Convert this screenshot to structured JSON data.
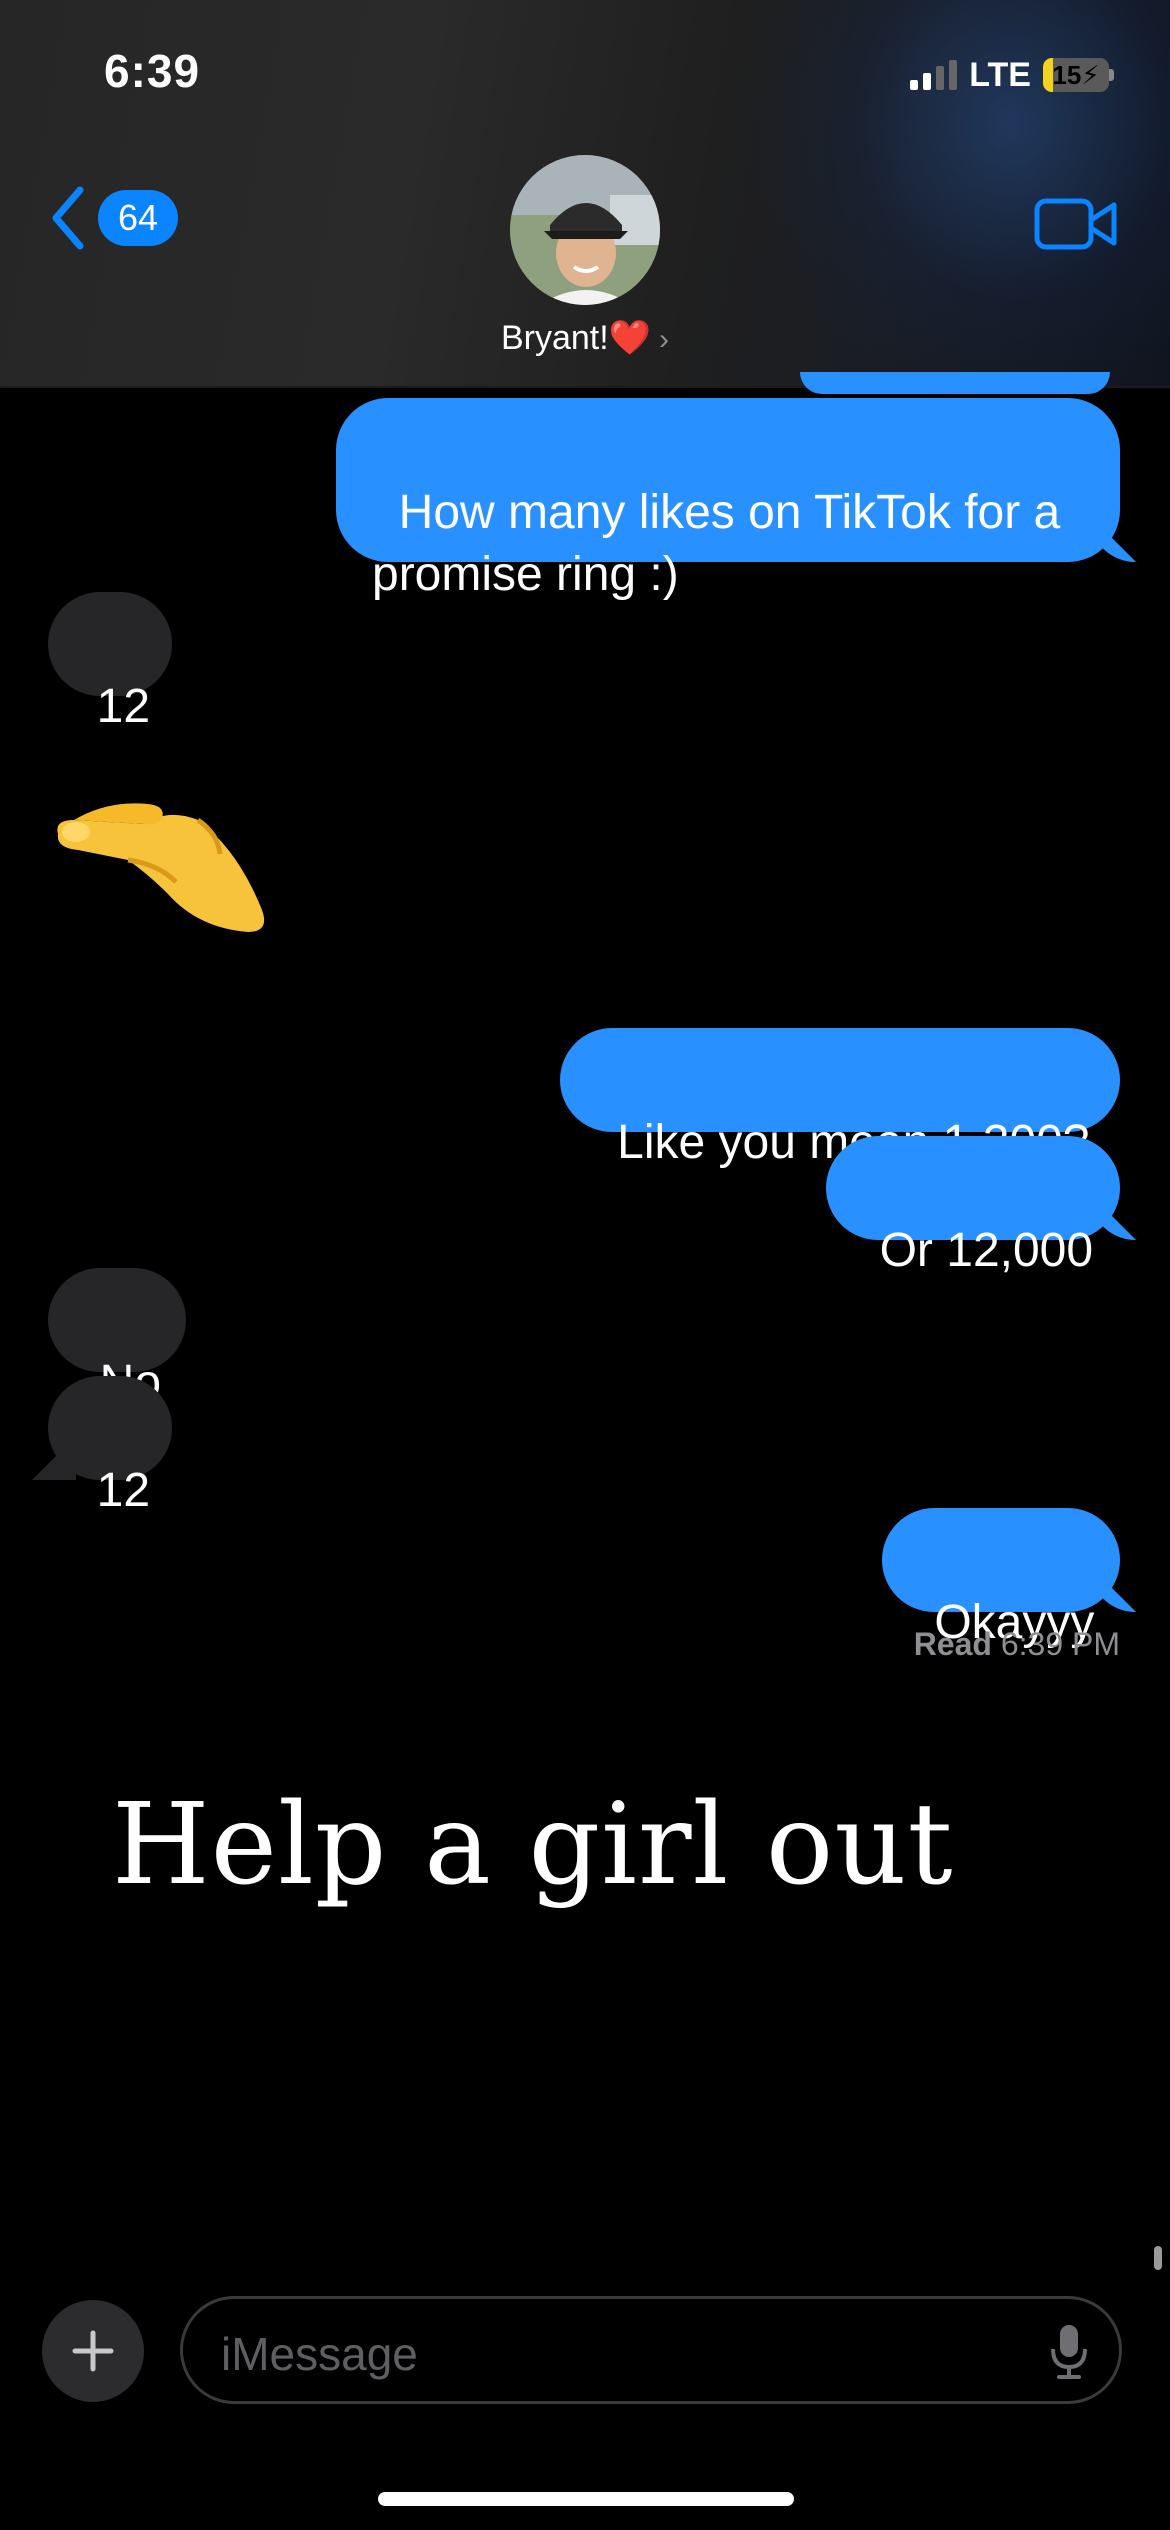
{
  "status_bar": {
    "time": "6:39",
    "network": "LTE",
    "battery": "15",
    "battery_level": 0.15,
    "charging": true
  },
  "nav": {
    "back_badge": "64",
    "contact_name": "Bryant!❤️",
    "chevron": "›"
  },
  "messages": [
    {
      "from": "me",
      "text": "How many likes on TikTok for a\npromise ring :)"
    },
    {
      "from": "them",
      "text": "12"
    },
    {
      "from": "them",
      "text": "🤏"
    },
    {
      "from": "me",
      "text": "Like you mean 1,200?"
    },
    {
      "from": "me",
      "text": "Or 12,000"
    },
    {
      "from": "them",
      "text": "No"
    },
    {
      "from": "them",
      "text": "12"
    },
    {
      "from": "me",
      "text": "Okayyy"
    }
  ],
  "read_receipt": {
    "label": "Read",
    "time": "6:39 PM"
  },
  "overlay_caption": "Help a girl out",
  "compose": {
    "placeholder": "iMessage"
  },
  "icons": {
    "back": "chevron-left-icon",
    "video": "video-camera-icon",
    "plus": "plus-icon",
    "mic": "microphone-icon"
  },
  "colors": {
    "sent_bubble": "#2891ff",
    "received_bubble": "#262628",
    "accent": "#0a84ff"
  }
}
